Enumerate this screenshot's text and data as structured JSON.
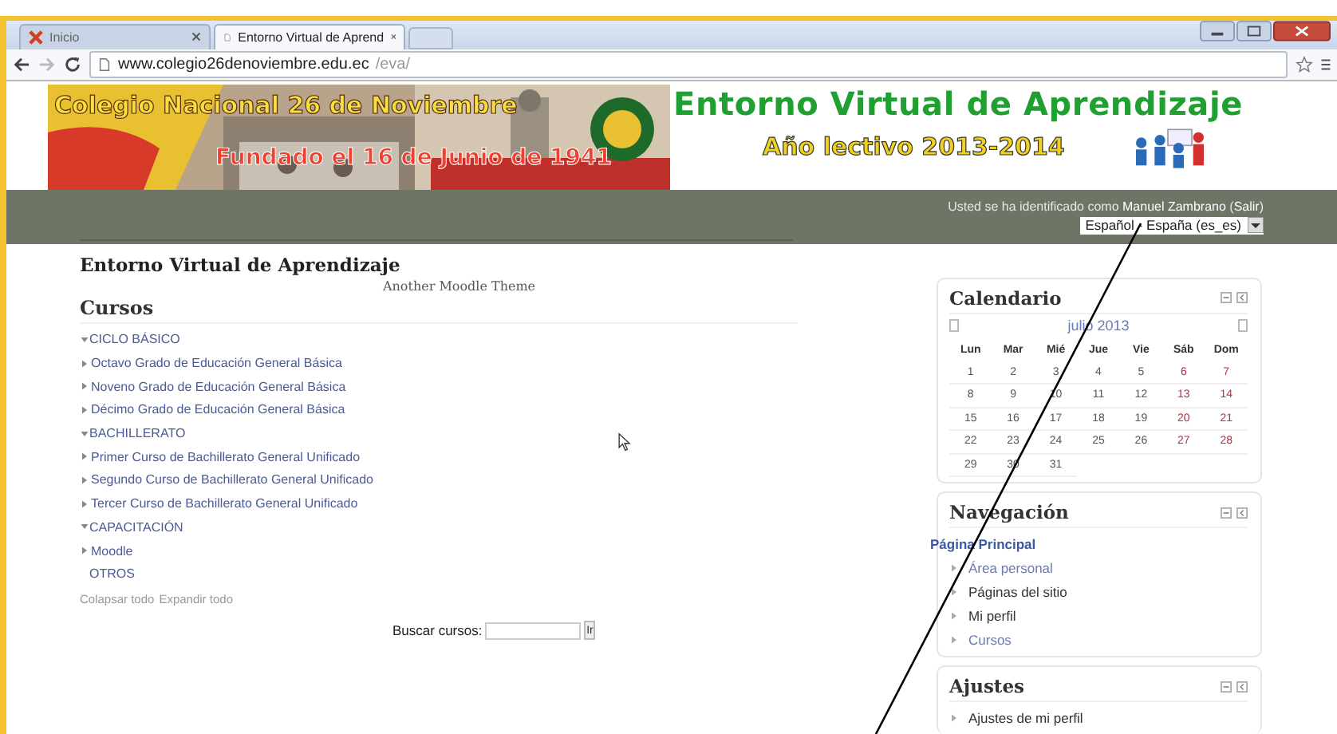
{
  "browser": {
    "tabs": [
      {
        "label": "Inicio",
        "selected": false
      },
      {
        "label": "Entorno Virtual de Aprend",
        "selected": true
      }
    ],
    "url": {
      "host": "www.colegio26denoviembre.edu.ec",
      "path": "/eva/"
    }
  },
  "banner": {
    "school": "Colegio Nacional 26 de Noviembre",
    "founded": "Fundado el 16 de Junio de 1941",
    "title": "Entorno Virtual de Aprendizaje",
    "year": "Año lectivo 2013-2014"
  },
  "login": {
    "prefix": "Usted se ha identificado como",
    "user": "Manuel Zambrano",
    "open": "(",
    "logout": "Salir",
    "close": ")",
    "language": "Español - España (es_es)"
  },
  "main": {
    "site_name": "Entorno Virtual de Aprendizaje",
    "theme": "Another Moodle Theme",
    "courses_title": "Cursos",
    "categories": [
      {
        "label": "CICLO BÁSICO",
        "expanded": true,
        "children": [
          {
            "label": "Octavo Grado de Educación General Básica",
            "expanded": false
          },
          {
            "label": "Noveno Grado de Educación General Básica",
            "expanded": false
          },
          {
            "label": "Décimo Grado de Educación General Básica",
            "expanded": false
          }
        ]
      },
      {
        "label": "BACHILLERATO",
        "expanded": true,
        "children": [
          {
            "label": "Primer Curso de Bachillerato General Unificado",
            "expanded": false
          },
          {
            "label": "Segundo Curso de Bachillerato General Unificado",
            "expanded": false
          },
          {
            "label": "Tercer Curso de Bachillerato General Unificado",
            "expanded": false
          }
        ]
      },
      {
        "label": "CAPACITACIÓN",
        "expanded": true,
        "children": [
          {
            "label": "Moodle",
            "expanded": false
          }
        ]
      },
      {
        "label": "OTROS"
      }
    ],
    "collapse_all": "Colapsar todo",
    "expand_all": "Expandir todo",
    "search_label": "Buscar cursos:",
    "search_button": "Ir"
  },
  "calendar": {
    "title": "Calendario",
    "month": "julio 2013",
    "weekdays": [
      "Lun",
      "Mar",
      "Mié",
      "Jue",
      "Vie",
      "Sáb",
      "Dom"
    ],
    "weeks": [
      [
        "1",
        "2",
        "3",
        "4",
        "5",
        "6",
        "7"
      ],
      [
        "8",
        "9",
        "10",
        "11",
        "12",
        "13",
        "14"
      ],
      [
        "15",
        "16",
        "17",
        "18",
        "19",
        "20",
        "21"
      ],
      [
        "22",
        "23",
        "24",
        "25",
        "26",
        "27",
        "28"
      ],
      [
        "29",
        "30",
        "31"
      ]
    ]
  },
  "navigation": {
    "title": "Navegación",
    "items": [
      {
        "label": "Página Principal",
        "kind": "home"
      },
      {
        "label": "Área personal",
        "kind": "link"
      },
      {
        "label": "Páginas del sitio",
        "kind": "branch"
      },
      {
        "label": "Mi perfil",
        "kind": "branch"
      },
      {
        "label": "Cursos",
        "kind": "link"
      }
    ]
  },
  "settings": {
    "title": "Ajustes",
    "items": [
      "Ajustes de mi perfil"
    ]
  }
}
